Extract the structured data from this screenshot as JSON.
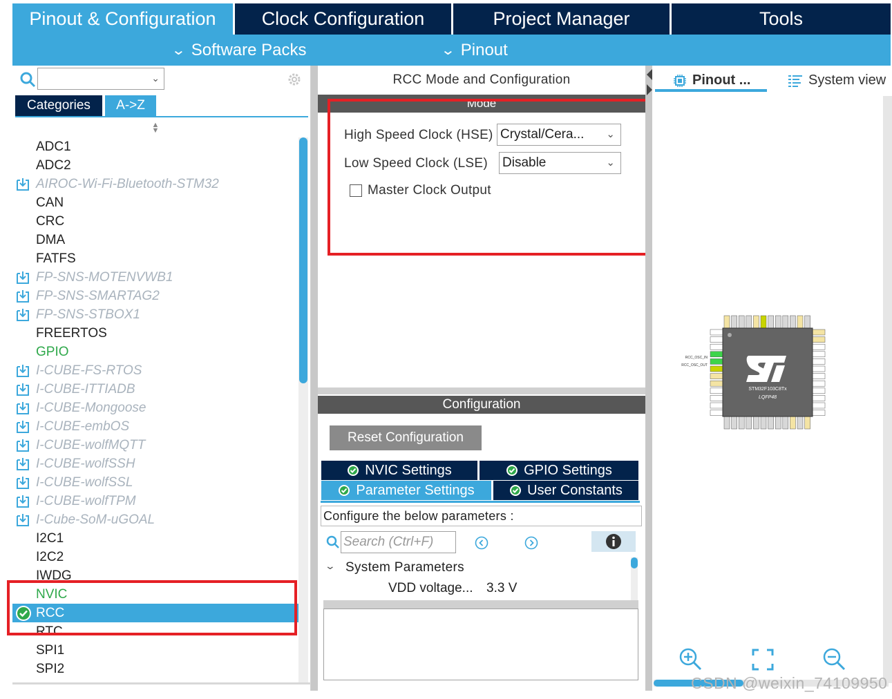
{
  "top_tabs": [
    {
      "label": "Pinout & Configuration",
      "active": true
    },
    {
      "label": "Clock Configuration",
      "active": false
    },
    {
      "label": "Project Manager",
      "active": false
    },
    {
      "label": "Tools",
      "active": false
    }
  ],
  "subbar": {
    "software_packs": "Software Packs",
    "pinout": "Pinout"
  },
  "left": {
    "search_value": "",
    "tabs": {
      "categories": "Categories",
      "az": "A->Z"
    },
    "items": [
      {
        "label": "ADC1",
        "kind": "normal"
      },
      {
        "label": "ADC2",
        "kind": "normal"
      },
      {
        "label": "AIROC-Wi-Fi-Bluetooth-STM32",
        "kind": "pack"
      },
      {
        "label": "CAN",
        "kind": "normal"
      },
      {
        "label": "CRC",
        "kind": "normal"
      },
      {
        "label": "DMA",
        "kind": "normal"
      },
      {
        "label": "FATFS",
        "kind": "normal"
      },
      {
        "label": "FP-SNS-MOTENVWB1",
        "kind": "pack"
      },
      {
        "label": "FP-SNS-SMARTAG2",
        "kind": "pack"
      },
      {
        "label": "FP-SNS-STBOX1",
        "kind": "pack"
      },
      {
        "label": "FREERTOS",
        "kind": "normal"
      },
      {
        "label": "GPIO",
        "kind": "green"
      },
      {
        "label": "I-CUBE-FS-RTOS",
        "kind": "pack"
      },
      {
        "label": "I-CUBE-ITTIADB",
        "kind": "pack"
      },
      {
        "label": "I-CUBE-Mongoose",
        "kind": "pack"
      },
      {
        "label": "I-CUBE-embOS",
        "kind": "pack"
      },
      {
        "label": "I-CUBE-wolfMQTT",
        "kind": "pack"
      },
      {
        "label": "I-CUBE-wolfSSH",
        "kind": "pack"
      },
      {
        "label": "I-CUBE-wolfSSL",
        "kind": "pack"
      },
      {
        "label": "I-CUBE-wolfTPM",
        "kind": "pack"
      },
      {
        "label": "I-Cube-SoM-uGOAL",
        "kind": "pack"
      },
      {
        "label": "I2C1",
        "kind": "normal"
      },
      {
        "label": "I2C2",
        "kind": "normal"
      },
      {
        "label": "IWDG",
        "kind": "normal"
      },
      {
        "label": "NVIC",
        "kind": "green"
      },
      {
        "label": "RCC",
        "kind": "selected"
      },
      {
        "label": "RTC",
        "kind": "normal"
      },
      {
        "label": "SPI1",
        "kind": "normal"
      },
      {
        "label": "SPI2",
        "kind": "normal"
      }
    ]
  },
  "middle": {
    "title": "RCC Mode and Configuration",
    "mode_header": "Mode",
    "hse_label": "High Speed Clock (HSE)",
    "hse_value": "Crystal/Cera...",
    "lse_label": "Low Speed Clock (LSE)",
    "lse_value": "Disable",
    "mco_label": "Master Clock Output",
    "mco_checked": false,
    "config_header": "Configuration",
    "reset_button": "Reset Configuration",
    "tabs": {
      "nvic": "NVIC Settings",
      "gpio": "GPIO Settings",
      "param": "Parameter Settings",
      "user": "User Constants"
    },
    "description": "Configure the below parameters :",
    "search_placeholder": "Search (Ctrl+F)",
    "group": "System Parameters",
    "param_name": "VDD voltage...",
    "param_value": "3.3 V"
  },
  "right": {
    "pinout_tab": "Pinout ...",
    "system_view_tab": "System view",
    "chip": {
      "name": "STM32F103C8Tx",
      "package": "LQFP48",
      "osc_in": "RCC_OSC_IN",
      "osc_out": "RCC_OSC_OUT"
    }
  },
  "watermark": "CSDN @weixin_74109950",
  "colors": {
    "navy": "#03234b",
    "accent": "#3ca8dc",
    "highlight": "#e52025",
    "green": "#2ea84a"
  }
}
